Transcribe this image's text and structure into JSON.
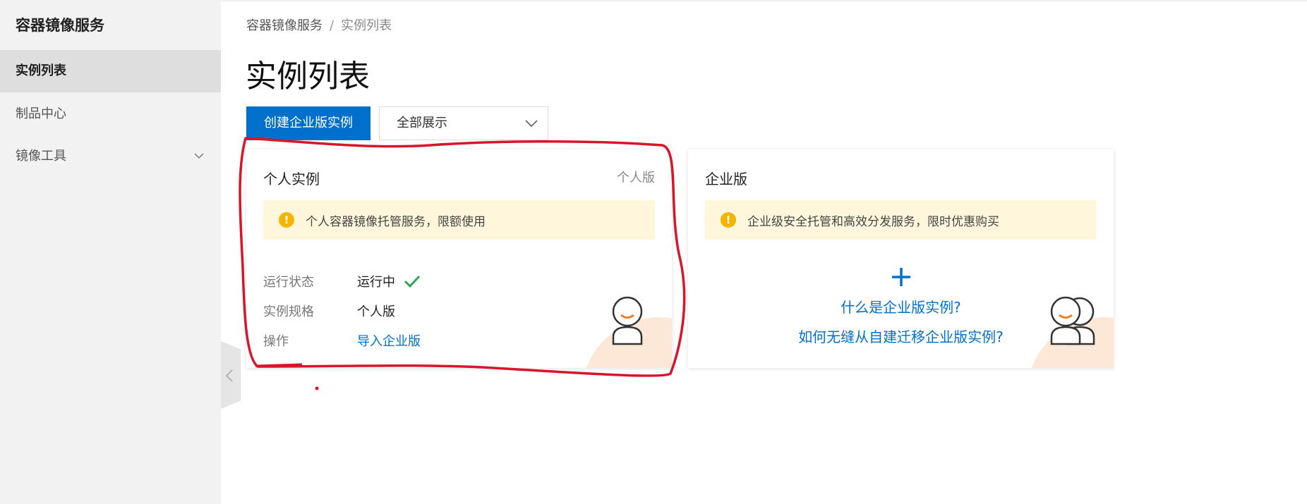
{
  "sidebar": {
    "title": "容器镜像服务",
    "items": [
      {
        "label": "实例列表",
        "active": true
      },
      {
        "label": "制品中心",
        "active": false
      },
      {
        "label": "镜像工具",
        "active": false,
        "expandable": true
      }
    ]
  },
  "breadcrumb": {
    "root": "容器镜像服务",
    "separator": "/",
    "current": "实例列表"
  },
  "page": {
    "title": "实例列表"
  },
  "toolbar": {
    "create_label": "创建企业版实例",
    "filter_selected": "全部展示"
  },
  "cards": {
    "personal": {
      "title": "个人实例",
      "tag": "个人版",
      "notice": "个人容器镜像托管服务，限额使用",
      "rows": {
        "status_label": "运行状态",
        "status_value": "运行中",
        "spec_label": "实例规格",
        "spec_value": "个人版",
        "action_label": "操作",
        "action_value": "导入企业版"
      }
    },
    "enterprise": {
      "title": "企业版",
      "notice": "企业级安全托管和高效分发服务，限时优惠购买",
      "link_what": "什么是企业版实例?",
      "link_migrate": "如何无缝从自建迁移企业版实例?"
    }
  },
  "colors": {
    "primary": "#0070cc",
    "notice_bg": "#fff6dc",
    "warning": "#f5b400",
    "success": "#2fa84f",
    "annotation": "#d9152b"
  },
  "icons": [
    "chevron-down-icon",
    "chevron-left-icon",
    "warning-icon",
    "check-icon",
    "plus-icon",
    "user-avatar-icon",
    "users-avatar-icon"
  ]
}
